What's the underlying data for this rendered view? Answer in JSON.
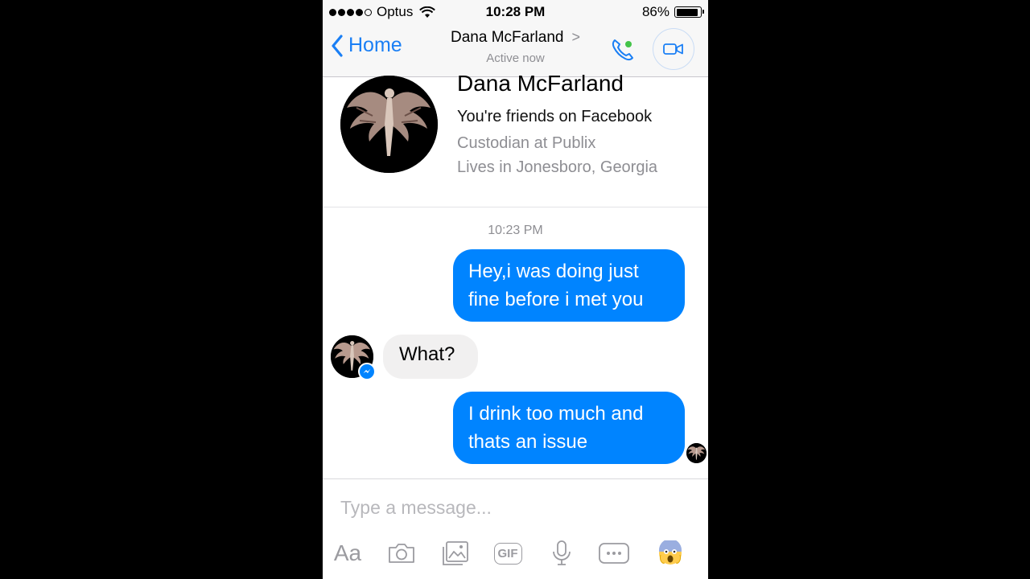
{
  "status_bar": {
    "carrier": "Optus",
    "time": "10:28 PM",
    "battery": "86%",
    "battery_level": 0.86
  },
  "nav": {
    "back_label": "Home",
    "contact_name": "Dana McFarland",
    "presence": "Active now",
    "icons": [
      "chevron-left-icon",
      "chevron-right-icon",
      "phone-icon",
      "video-camera-icon"
    ],
    "colors": {
      "accent": "#1a7ff5",
      "online": "#44c449"
    }
  },
  "profile": {
    "name": "Dana McFarland",
    "friends": "You're friends on Facebook",
    "work": "Custodian at Publix",
    "lives": "Lives in Jonesboro, Georgia"
  },
  "conversation": {
    "timestamp": "10:23 PM",
    "messages": [
      {
        "direction": "outgoing",
        "lines": [
          "Hey,i was doing just",
          "fine before i met you"
        ]
      },
      {
        "direction": "incoming",
        "lines": [
          "What?"
        ]
      },
      {
        "direction": "outgoing",
        "lines": [
          "I drink too much and",
          "thats an issue"
        ]
      }
    ],
    "colors": {
      "outgoing_bubble": "#0084ff",
      "incoming_bubble": "#f1f0f0"
    }
  },
  "composer": {
    "placeholder": "Type a message...",
    "tools": {
      "text": "Aa",
      "gif": "GIF",
      "icons": [
        "text-format-icon",
        "camera-icon",
        "photo-icon",
        "gif-icon",
        "microphone-icon",
        "more-icon",
        "emoji-icon"
      ]
    }
  }
}
